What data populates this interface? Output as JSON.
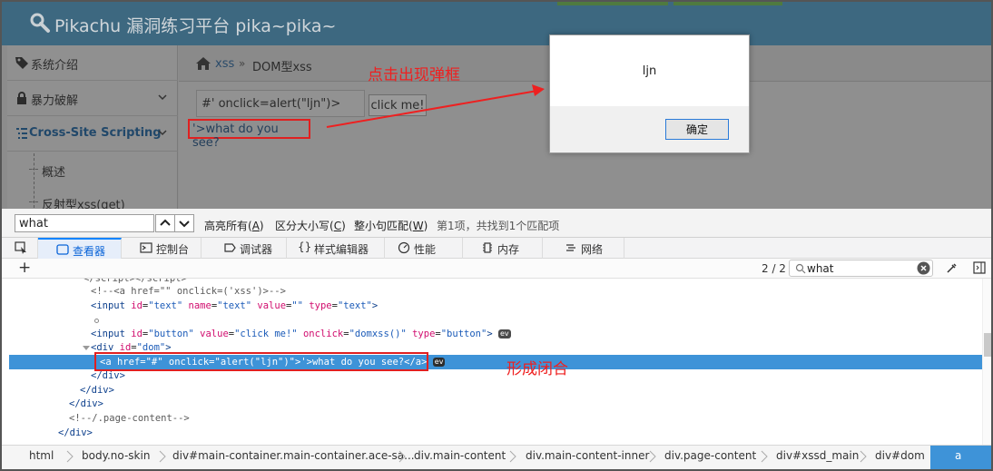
{
  "header": {
    "title": "Pikachu 漏洞练习平台 pika~pika~"
  },
  "sidebar": {
    "items": [
      {
        "label": "系统介绍"
      },
      {
        "label": "暴力破解"
      },
      {
        "label": "Cross-Site Scripting"
      }
    ],
    "subitems": [
      {
        "label": "概述"
      },
      {
        "label": "反射型xss(get)"
      }
    ]
  },
  "breadcrumb": {
    "section": "xss",
    "separator": "»",
    "page": "DOM型xss"
  },
  "xss_form": {
    "input_value": "#' onclick=alert(\"ljn\")>",
    "button_label": "click me!",
    "result_link": "'>what do you see?"
  },
  "annotations": {
    "popup": "点击出现弹框",
    "closure": "形成闭合"
  },
  "dialog": {
    "message": "ljn",
    "ok_label": "确定"
  },
  "findbar": {
    "query": "what",
    "highlight_all": "高亮所有(",
    "highlight_all_key": "A",
    "match_case": "区分大小写(",
    "match_case_key": "C",
    "whole_words": "整小句匹配(",
    "whole_words_key": "W",
    "close_paren": ")",
    "status": "第1项，共找到1个匹配项"
  },
  "devtools": {
    "tabs": [
      {
        "label": "查看器"
      },
      {
        "label": "控制台"
      },
      {
        "label": "调试器"
      },
      {
        "label": "样式编辑器"
      },
      {
        "label": "性能"
      },
      {
        "label": "内存"
      },
      {
        "label": "网络"
      }
    ],
    "search": {
      "count": "2 / 2",
      "query": "what"
    }
  },
  "markup": {
    "lines": {
      "comment1": "<!--<a href=\"\" onclick=('xss')>-->",
      "tag_open": "<",
      "tag_close": ">",
      "input": "input",
      "id_attr": "id",
      "name_attr": "name",
      "value_attr": "value",
      "type_attr": "type",
      "onclick_attr": "onclick",
      "href_attr": "href",
      "eq": "=",
      "text_id": "\"text\"",
      "text_name": "\"text\"",
      "empty_value": "\"\"",
      "text_type": "\"text\"",
      "button_id": "\"button\"",
      "button_value": "\"click me!\"",
      "button_onclick": "\"domxss()\"",
      "button_type": "\"button\"",
      "div": "div",
      "dom_id": "\"dom\"",
      "a": "a",
      "a_href": "\"#\"",
      "a_onclick": "\"alert(\"ljn\")\"",
      "a_text": "'>what do you see?",
      "a_end": "</a>",
      "div_end": "</div>",
      "comment2": "<!--/.page-content-->",
      "ev": "ev"
    }
  },
  "pathbar": {
    "items": [
      "html",
      "body.no-skin",
      "div#main-container.main-container.ace-sa...",
      "div.main-content",
      "div.main-content-inner",
      "div.page-content",
      "div#xssd_main",
      "div#dom",
      "a"
    ]
  }
}
